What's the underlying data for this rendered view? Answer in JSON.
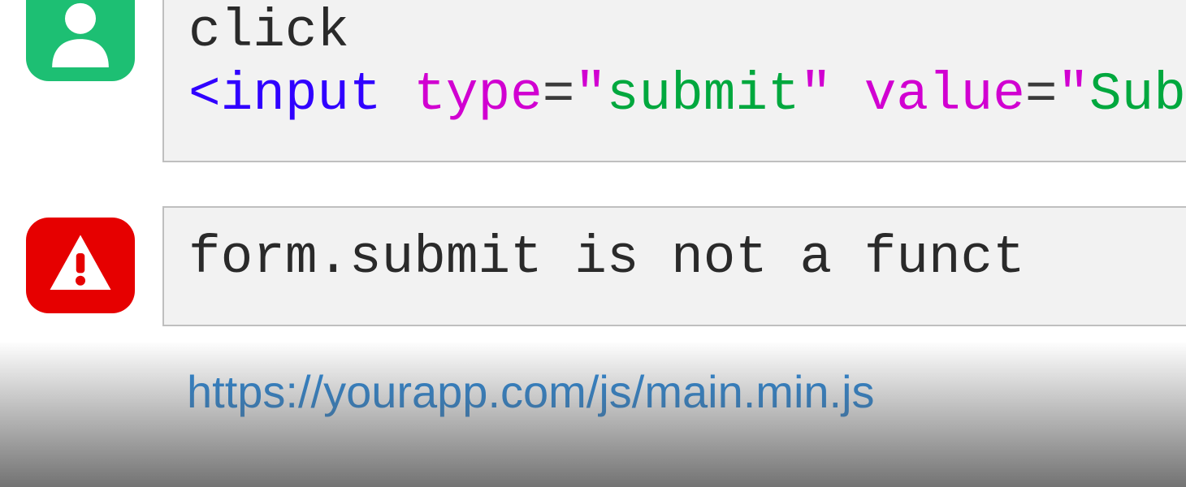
{
  "icons": {
    "user": "user-icon",
    "error": "warning-icon"
  },
  "action": {
    "word": "click",
    "code": {
      "open": "<",
      "tag": "input",
      "space": " ",
      "attr1": "type",
      "eq": "=",
      "q": "\"",
      "val1": "submit",
      "attr2": "value",
      "val2": "Sub"
    }
  },
  "error": {
    "message": "form.submit is not a funct"
  },
  "source": {
    "url": "https://yourapp.com/js/main.min.js"
  }
}
